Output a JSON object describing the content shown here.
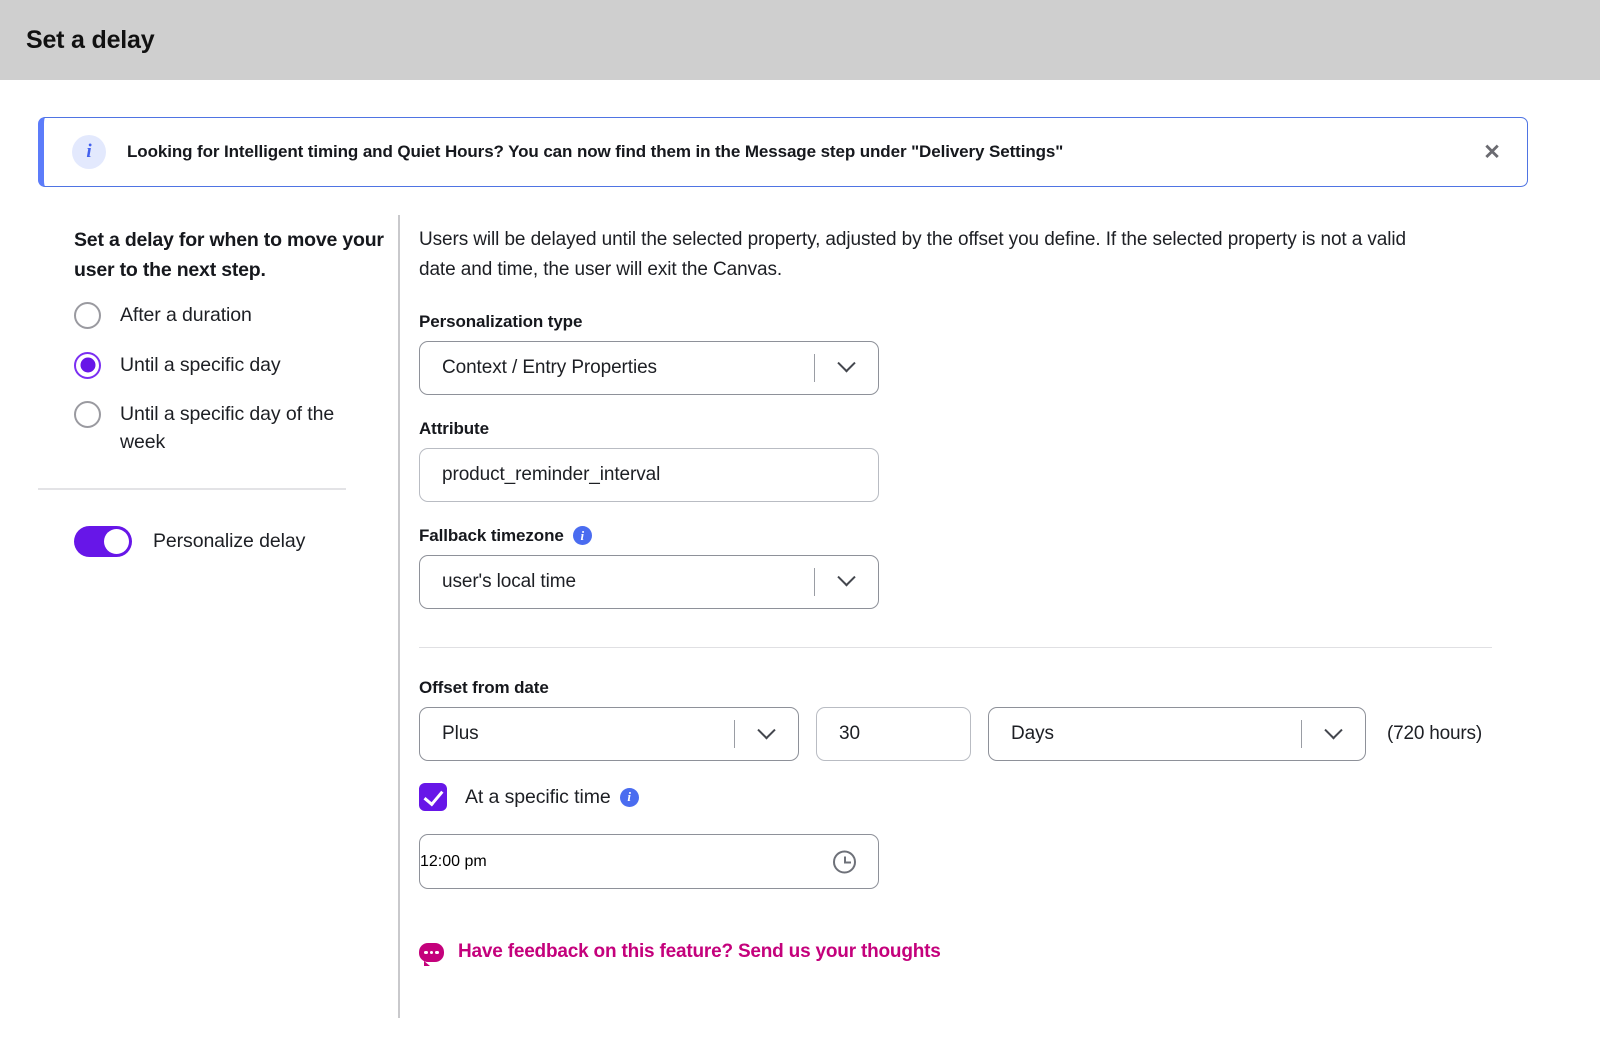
{
  "window": {
    "title": "Set a delay"
  },
  "banner": {
    "icon": "info-icon",
    "message": "Looking for Intelligent timing and Quiet Hours? You can now find them in the Message step under \"Delivery Settings\"",
    "close_icon": "close-icon",
    "accent_color": "#5c7cfa"
  },
  "sidebar": {
    "heading": "Set a delay for when to move your user to the next step.",
    "options": [
      {
        "label": "After a duration",
        "selected": false
      },
      {
        "label": "Until a specific day",
        "selected": true
      },
      {
        "label": "Until a specific day of the week",
        "selected": false
      }
    ],
    "toggle": {
      "label": "Personalize delay",
      "on": true,
      "color": "#6716e8"
    }
  },
  "main": {
    "description": "Users will be delayed until the selected property, adjusted by the offset you define. If the selected property is not a valid date and time, the user will exit the Canvas.",
    "personalization_type": {
      "label": "Personalization type",
      "value": "Context / Entry Properties",
      "caret_icon": "chevron-down-icon"
    },
    "attribute": {
      "label": "Attribute",
      "value": "product_reminder_interval"
    },
    "fallback_timezone": {
      "label": "Fallback timezone",
      "info_icon": "info-icon",
      "value": "user's local time",
      "caret_icon": "chevron-down-icon"
    },
    "offset": {
      "label": "Offset from date",
      "direction": "Plus",
      "amount": "30",
      "unit": "Days",
      "note": "(720 hours)"
    },
    "specific_time": {
      "checkbox_label": "At a specific time",
      "checked": true,
      "info_icon": "info-icon",
      "value": "12:00 pm",
      "clock_icon": "clock-icon"
    },
    "feedback": {
      "icon": "chat-bubble-icon",
      "text": "Have feedback on this feature? Send us your thoughts",
      "color": "#c4017c"
    }
  }
}
